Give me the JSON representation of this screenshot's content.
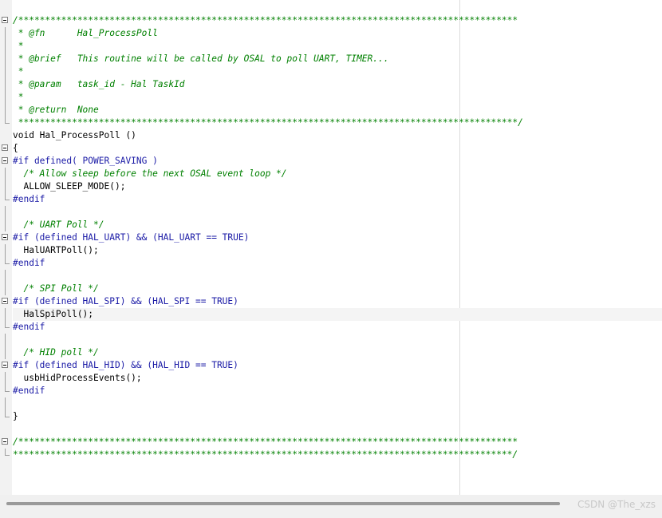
{
  "code_lines": [
    {
      "text": "/*********************************************************************************************",
      "type": "comment",
      "fold": "start"
    },
    {
      "text": " * @fn      Hal_ProcessPoll",
      "type": "comment",
      "fold": "bar"
    },
    {
      "text": " *",
      "type": "comment",
      "fold": "bar"
    },
    {
      "text": " * @brief   This routine will be called by OSAL to poll UART, TIMER...",
      "type": "comment",
      "fold": "bar"
    },
    {
      "text": " *",
      "type": "comment",
      "fold": "bar"
    },
    {
      "text": " * @param   task_id - Hal TaskId",
      "type": "comment",
      "fold": "bar"
    },
    {
      "text": " *",
      "type": "comment",
      "fold": "bar"
    },
    {
      "text": " * @return  None",
      "type": "comment",
      "fold": "bar"
    },
    {
      "text": " *********************************************************************************************/",
      "type": "comment",
      "fold": "end"
    },
    {
      "text": "void Hal_ProcessPoll ()",
      "type": "code",
      "fold": "none"
    },
    {
      "text": "{",
      "type": "code",
      "fold": "start"
    },
    {
      "text": "#if defined( POWER_SAVING )",
      "type": "pp",
      "fold": "start"
    },
    {
      "text": "  /* Allow sleep before the next OSAL event loop */",
      "type": "comment",
      "fold": "bar"
    },
    {
      "text": "  ALLOW_SLEEP_MODE();",
      "type": "code",
      "fold": "bar"
    },
    {
      "text": "#endif",
      "type": "pp",
      "fold": "end"
    },
    {
      "text": "",
      "type": "code",
      "fold": "bar"
    },
    {
      "text": "  /* UART Poll */",
      "type": "comment",
      "fold": "bar"
    },
    {
      "text": "#if (defined HAL_UART) && (HAL_UART == TRUE)",
      "type": "pp",
      "fold": "start"
    },
    {
      "text": "  HalUARTPoll();",
      "type": "code",
      "fold": "bar"
    },
    {
      "text": "#endif",
      "type": "pp",
      "fold": "end"
    },
    {
      "text": "",
      "type": "code",
      "fold": "bar"
    },
    {
      "text": "  /* SPI Poll */",
      "type": "comment",
      "fold": "bar"
    },
    {
      "text": "#if (defined HAL_SPI) && (HAL_SPI == TRUE)",
      "type": "pp",
      "fold": "start"
    },
    {
      "text": "  HalSpiPoll();",
      "type": "code",
      "fold": "bar",
      "current": true
    },
    {
      "text": "#endif",
      "type": "pp",
      "fold": "end"
    },
    {
      "text": "",
      "type": "code",
      "fold": "bar"
    },
    {
      "text": "  /* HID poll */",
      "type": "comment",
      "fold": "bar"
    },
    {
      "text": "#if (defined HAL_HID) && (HAL_HID == TRUE)",
      "type": "pp",
      "fold": "start"
    },
    {
      "text": "  usbHidProcessEvents();",
      "type": "code",
      "fold": "bar"
    },
    {
      "text": "#endif",
      "type": "pp",
      "fold": "end"
    },
    {
      "text": "",
      "type": "code",
      "fold": "bar"
    },
    {
      "text": "}",
      "type": "code",
      "fold": "end"
    },
    {
      "text": "",
      "type": "code",
      "fold": "none"
    },
    {
      "text": "/*********************************************************************************************",
      "type": "comment",
      "fold": "start"
    },
    {
      "text": "*********************************************************************************************/",
      "type": "comment",
      "fold": "end"
    }
  ],
  "watermark": "CSDN @The_xzs",
  "colors": {
    "comment": "#008000",
    "preprocessor": "#1a1aa6",
    "code": "#000000",
    "current_line": "#f4f4f4"
  }
}
